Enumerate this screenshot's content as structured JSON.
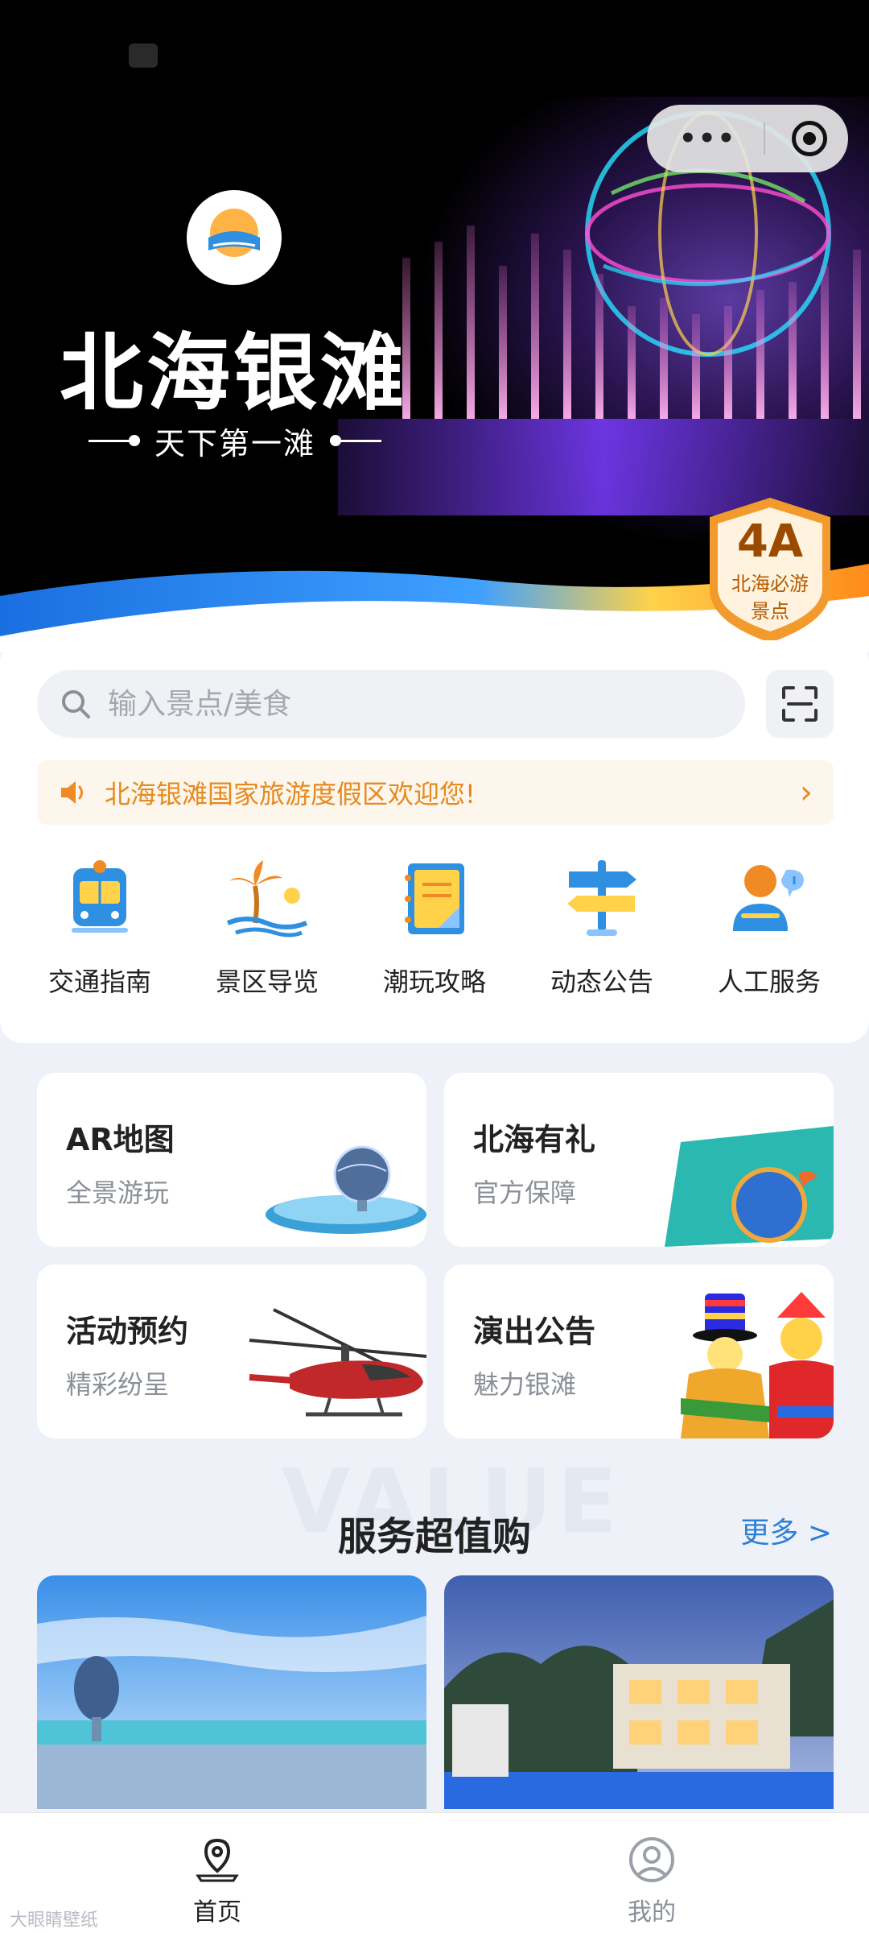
{
  "hero": {
    "title": "北海银滩",
    "subtitle": "天下第一滩",
    "badge_grade": "4A",
    "badge_line1": "北海必游",
    "badge_line2": "景点",
    "capsule_menu_icon": "more-dots-icon",
    "capsule_close_icon": "target-icon"
  },
  "search": {
    "placeholder": "输入景点/美食",
    "scan_icon": "scan-icon"
  },
  "notice": {
    "text": "北海银滩国家旅游度假区欢迎您!",
    "icon": "speaker-icon"
  },
  "nav": [
    {
      "label": "交通指南",
      "icon": "train-icon"
    },
    {
      "label": "景区导览",
      "icon": "island-icon"
    },
    {
      "label": "潮玩攻略",
      "icon": "notebook-icon"
    },
    {
      "label": "动态公告",
      "icon": "signpost-icon"
    },
    {
      "label": "人工服务",
      "icon": "support-person-icon"
    }
  ],
  "features": [
    {
      "title": "AR地图",
      "subtitle": "全景游玩"
    },
    {
      "title": "北海有礼",
      "subtitle": "官方保障"
    },
    {
      "title": "活动预约",
      "subtitle": "精彩纷呈"
    },
    {
      "title": "演出公告",
      "subtitle": "魅力银滩"
    }
  ],
  "section": {
    "bg_word": "VALUE",
    "title": "服务超值购",
    "more": "更多 >"
  },
  "tabbar": {
    "home": "首页",
    "mine": "我的"
  },
  "watermark": "大眼睛壁纸",
  "colors": {
    "accent_blue": "#2c7fd6",
    "notice_orange": "#e58a1f",
    "badge_orange": "#f39a2c"
  }
}
